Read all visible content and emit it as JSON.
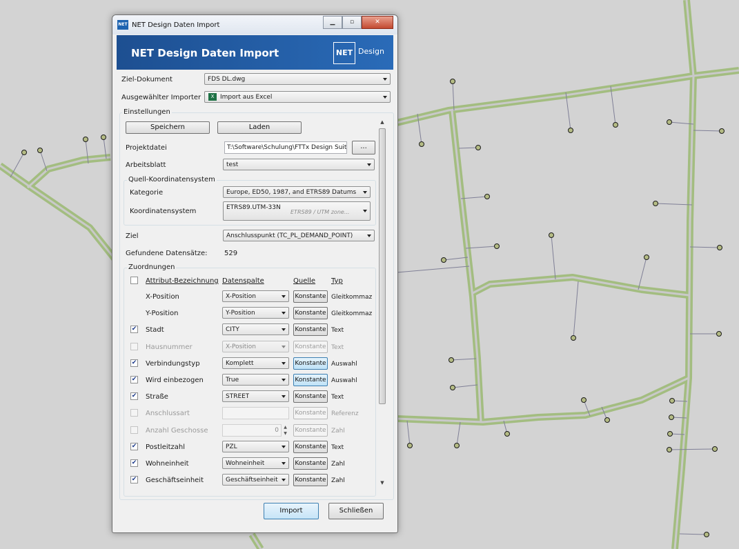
{
  "window": {
    "title": "NET Design Daten Import",
    "app_icon": "NET",
    "controls": [
      "minimize",
      "maximize",
      "close"
    ]
  },
  "banner": {
    "title": "NET Design Daten Import",
    "logo": "NET",
    "logo_text": "Design"
  },
  "top": {
    "ziel_dokument_label": "Ziel-Dokument",
    "ziel_dokument_value": "FDS DL.dwg",
    "importer_label": "Ausgewählter Importer",
    "importer_value": "Import aus Excel"
  },
  "einstellungen": {
    "legend": "Einstellungen",
    "save_label": "Speichern",
    "load_label": "Laden",
    "projektdatei_label": "Projektdatei",
    "projektdatei_value": "T:\\Software\\Schulung\\FTTx Design Suit",
    "browse_label": "...",
    "arbeitsblatt_label": "Arbeitsblatt",
    "arbeitsblatt_value": "test",
    "coord_legend": "Quell-Koordinatensystem",
    "kategorie_label": "Kategorie",
    "kategorie_value": "Europe, ED50, 1987, and ETRS89 Datums",
    "koordsys_label": "Koordinatensystem",
    "koordsys_value": "ETRS89.UTM-33N",
    "koordsys_hint": "ETRS89 / UTM zone...",
    "ziel_label": "Ziel",
    "ziel_value": "Anschlusspunkt (TC_PL_DEMAND_POINT)",
    "found_label": "Gefundene Datensätze:",
    "found_value": "529"
  },
  "zuordnungen": {
    "legend": "Zuordnungen",
    "headers": {
      "attr": "Attribut-Bezeichnung",
      "col": "Datenspalte",
      "src": "Quelle",
      "typ": "Typ"
    },
    "rows": [
      {
        "checkbox": "none",
        "name": "X-Position",
        "col": "X-Position",
        "src": "Konstante",
        "typ": "Gleitkommaz",
        "disabled": false,
        "active": false
      },
      {
        "checkbox": "none",
        "name": "Y-Position",
        "col": "Y-Position",
        "src": "Konstante",
        "typ": "Gleitkommaz",
        "disabled": false,
        "active": false
      },
      {
        "checkbox": "checked",
        "name": "Stadt",
        "col": "CITY",
        "src": "Konstante",
        "typ": "Text",
        "disabled": false,
        "active": false
      },
      {
        "checkbox": "unchecked",
        "name": "Hausnummer",
        "col": "X-Position",
        "src": "Konstante",
        "typ": "Text",
        "disabled": true,
        "active": false
      },
      {
        "checkbox": "checked",
        "name": "Verbindungstyp",
        "col": "Komplett",
        "src": "Konstante",
        "typ": "Auswahl",
        "disabled": false,
        "active": true
      },
      {
        "checkbox": "checked",
        "name": "Wird einbezogen",
        "col": "True",
        "src": "Konstante",
        "typ": "Auswahl",
        "disabled": false,
        "active": true
      },
      {
        "checkbox": "checked",
        "name": "Straße",
        "col": "STREET",
        "src": "Konstante",
        "typ": "Text",
        "disabled": false,
        "active": false
      },
      {
        "checkbox": "unchecked",
        "name": "Anschlussart",
        "col": "",
        "src": "Konstante",
        "typ": "Referenz",
        "disabled": true,
        "active": false,
        "control": "textbox"
      },
      {
        "checkbox": "unchecked",
        "name": "Anzahl Geschosse",
        "col": "0",
        "src": "Konstante",
        "typ": "Zahl",
        "disabled": true,
        "active": false,
        "control": "spinner"
      },
      {
        "checkbox": "checked",
        "name": "Postleitzahl",
        "col": "PZL",
        "src": "Konstante",
        "typ": "Text",
        "disabled": false,
        "active": false
      },
      {
        "checkbox": "checked",
        "name": "Wohneinheit",
        "col": "Wohneinheit",
        "src": "Konstante",
        "typ": "Zahl",
        "disabled": false,
        "active": false
      },
      {
        "checkbox": "checked",
        "name": "Geschäftseinheit",
        "col": "Geschäftseinheit",
        "src": "Konstante",
        "typ": "Zahl",
        "disabled": false,
        "active": false
      }
    ]
  },
  "footer": {
    "import_label": "Import",
    "close_label": "Schließen"
  },
  "colors": {
    "road": "#a3bd80",
    "road_center": "#c9c9c9",
    "map_bg": "#d3d3d3",
    "banner": "#1d4f91",
    "point_fill": "#b4bb84"
  }
}
